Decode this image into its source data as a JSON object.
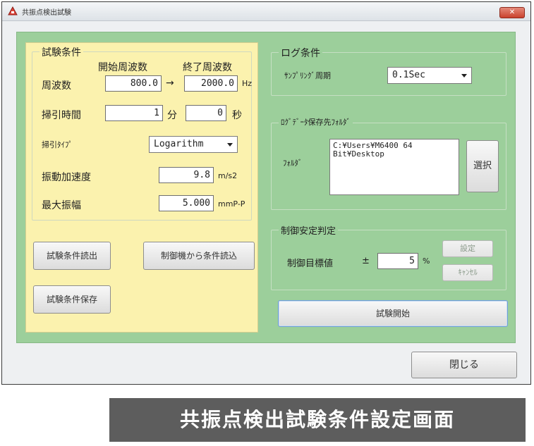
{
  "window": {
    "title": "共振点検出試験",
    "close_label": "✕"
  },
  "test_conditions": {
    "group_title": "試験条件",
    "freq_label": "周波数",
    "start_freq_label": "開始周波数",
    "end_freq_label": "終了周波数",
    "start_freq": "800.0",
    "arrow": "→",
    "end_freq": "2000.0",
    "freq_unit": "Hz",
    "sweep_time_label": "掃引時間",
    "sweep_min": "1",
    "min_unit": "分",
    "sweep_sec": "0",
    "sec_unit": "秒",
    "sweep_type_label": "掃引ﾀｲﾌﾟ",
    "sweep_type_value": "Logarithm",
    "accel_label": "振動加速度",
    "accel_value": "9.8",
    "accel_unit": "m/s2",
    "amplitude_label": "最大振幅",
    "amplitude_value": "5.000",
    "amplitude_unit": "mmP-P"
  },
  "left_buttons": {
    "read_conditions": "試験条件読出",
    "read_from_controller": "制御機から条件読込",
    "save_conditions": "試験条件保存"
  },
  "log_conditions": {
    "group_title": "ログ条件",
    "sampling_label": "ｻﾝﾌﾟﾘﾝｸﾞ周期",
    "sampling_value": "0.1Sec"
  },
  "log_folder": {
    "group_title": "ﾛｸﾞﾃﾞｰﾀ保存先ﾌｫﾙﾀﾞ",
    "folder_label": "ﾌｫﾙﾀﾞ",
    "folder_path": "C:¥Users¥M6400 64\nBit¥Desktop",
    "select_button": "選択"
  },
  "control_stability": {
    "group_title": "制御安定判定",
    "target_label": "制御目標値",
    "plusminus": "±",
    "target_value": "5",
    "percent": "%",
    "set_button": "設定",
    "cancel_button": "ｷｬﾝｾﾙ"
  },
  "start_button": "試験開始",
  "close_button": "閉じる",
  "caption": "共振点検出試験条件設定画面"
}
